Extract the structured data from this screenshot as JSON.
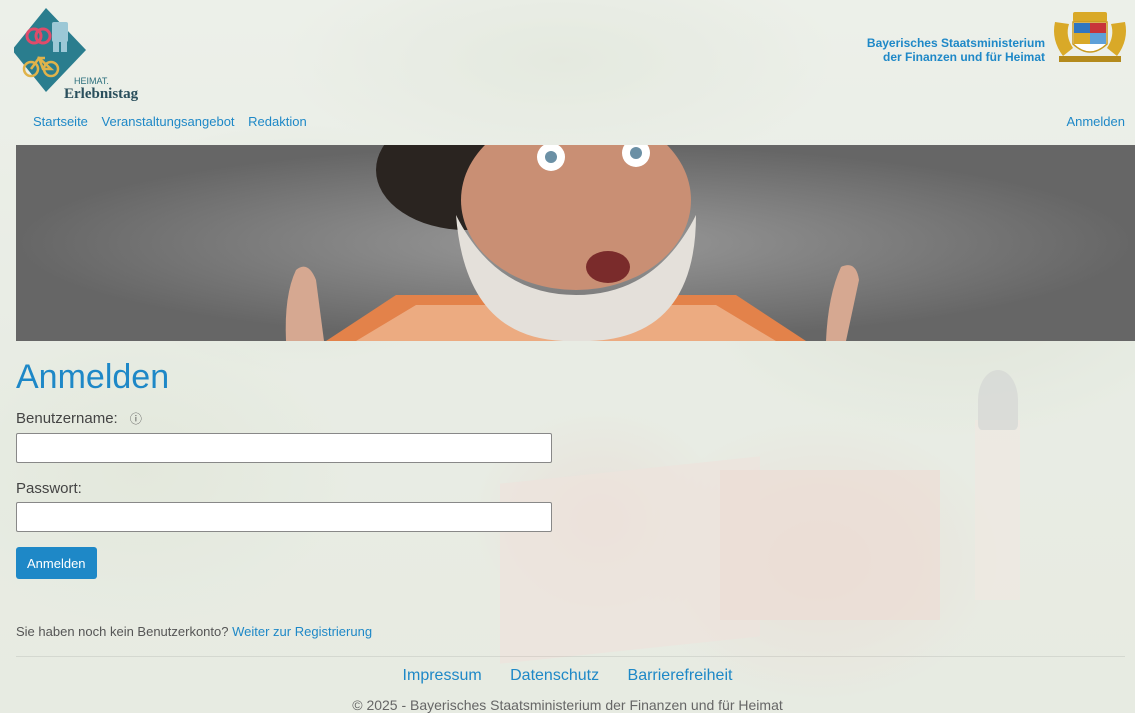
{
  "header": {
    "logo_text_top": "HEIMAT.",
    "logo_text_bottom": "Erlebnistag",
    "ministry_line1": "Bayerisches Staatsministerium",
    "ministry_line2": "der Finanzen und für Heimat"
  },
  "nav": {
    "items": [
      "Startseite",
      "Veranstaltungsangebot",
      "Redaktion"
    ],
    "login": "Anmelden"
  },
  "form": {
    "title": "Anmelden",
    "username_label": "Benutzername:",
    "info_icon": "ⓘ",
    "username_value": "",
    "password_label": "Passwort:",
    "password_value": "",
    "submit_label": "Anmelden",
    "register_prompt": "Sie haben noch kein Benutzerkonto?",
    "register_link": "Weiter zur Registrierung"
  },
  "footer": {
    "links": [
      "Impressum",
      "Datenschutz",
      "Barrierefreiheit"
    ],
    "copyright": "© 2025 - Bayerisches Staatsministerium der Finanzen und für Heimat"
  },
  "colors": {
    "accent": "#1e88c7",
    "logo_diamond": "#2a7d8e"
  }
}
